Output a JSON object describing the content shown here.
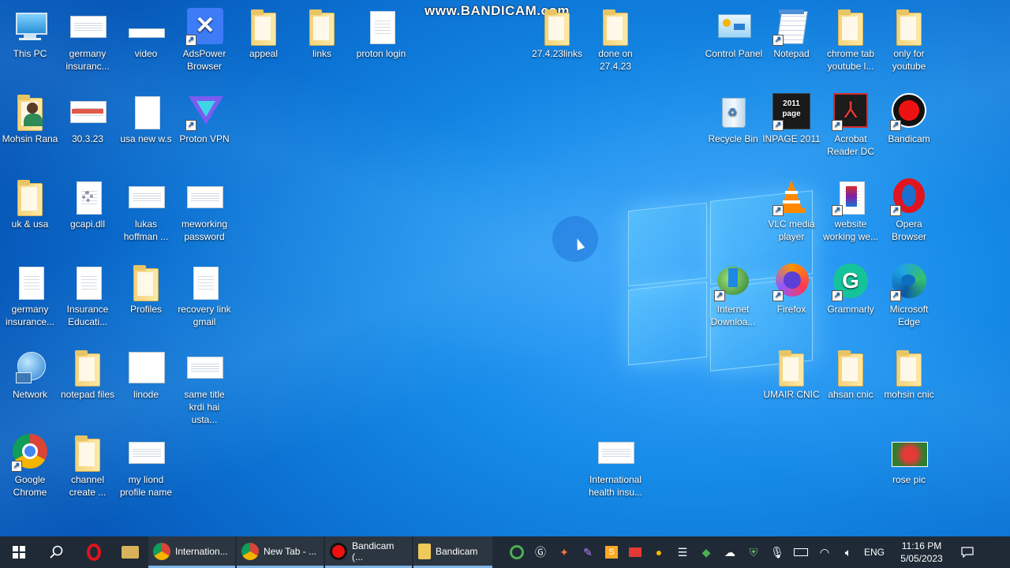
{
  "watermark": "www.BANDICAM.com",
  "desktop_icons": {
    "this_pc": "This PC",
    "germany_insurance": "germany\ninsuranc...",
    "video": "video",
    "adspower": "AdsPower\nBrowser",
    "appeal": "appeal",
    "links": "links",
    "proton_login": "proton login",
    "links_27": "27.4.23links",
    "done_on": "done on\n27.4.23",
    "control_panel": "Control Panel",
    "notepad": "Notepad",
    "chrome_tab": "chrome tab\nyoutube l...",
    "only_youtube": "only for\nyoutube",
    "mohsin_rana": "Mohsin Rana",
    "date_30": "30.3.23",
    "usa_new": "usa new w.s",
    "proton_vpn": "Proton VPN",
    "recycle_bin": "Recycle Bin",
    "inpage": "INPAGE 2011",
    "acrobat": "Acrobat\nReader DC",
    "bandicam": "Bandicam",
    "uk_usa": "uk & usa",
    "gcapi": "gcapi.dll",
    "lukas": "lukas\nhoffman ...",
    "meworking": "meworking\npassword",
    "vlc": "VLC media\nplayer",
    "website": "website\nworking we...",
    "opera": "Opera\nBrowser",
    "germany_insurance2": "germany\ninsurance...",
    "insurance_edu": "Insurance\nEducati...",
    "profiles": "Profiles",
    "recovery": "recovery link\ngmail",
    "idm": "Internet\nDownloa...",
    "firefox": "Firefox",
    "grammarly": "Grammarly",
    "edge": "Microsoft\nEdge",
    "network": "Network",
    "notepad_files": "notepad files",
    "linode": "linode",
    "same_title": "same title\nkrdi hai usta...",
    "umair": "UMAIR CNIC",
    "ahsan": "ahsan cnic",
    "mohsin_cnic": "mohsin cnic",
    "google_chrome": "Google\nChrome",
    "channel": "channel\ncreate ...",
    "my_liond": "my liond\nprofile name",
    "international_health": "International\nhealth insu...",
    "rose_pic": "rose pic",
    "inpage_logo_text": "2011\npage"
  },
  "taskbar": {
    "apps": [
      {
        "label": "Internation..."
      },
      {
        "label": "New Tab - ..."
      },
      {
        "label": "Bandicam (..."
      },
      {
        "label": "Bandicam"
      }
    ],
    "language": "ENG",
    "time": "11:16 PM",
    "date": "5/05/2023"
  }
}
